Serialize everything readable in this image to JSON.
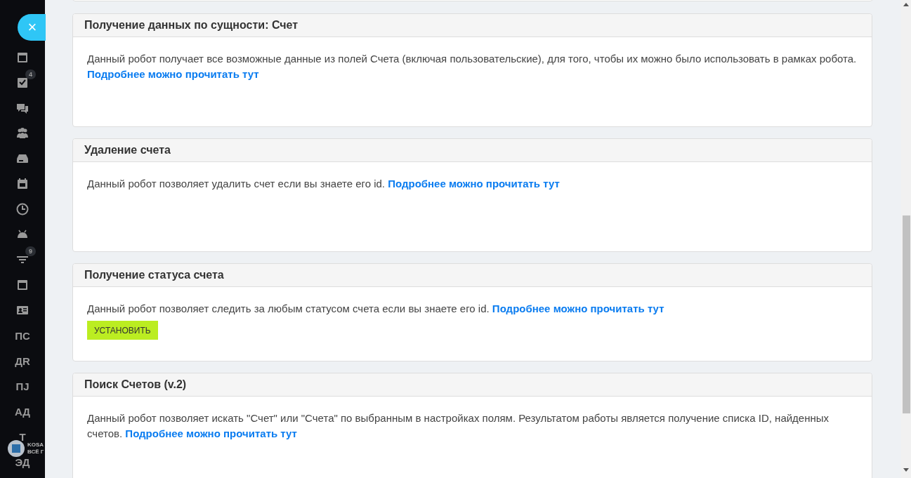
{
  "sidebar": {
    "close_button": "×",
    "items": [
      {
        "kind": "icon"
      },
      {
        "kind": "icon",
        "badge": "4"
      },
      {
        "kind": "icon"
      },
      {
        "kind": "icon"
      },
      {
        "kind": "icon"
      },
      {
        "kind": "icon"
      },
      {
        "kind": "icon"
      },
      {
        "kind": "icon"
      },
      {
        "kind": "icon",
        "badge": "9"
      },
      {
        "kind": "icon"
      },
      {
        "kind": "icon"
      },
      {
        "kind": "text",
        "label": "ПС"
      },
      {
        "kind": "text",
        "label": "ДR"
      },
      {
        "kind": "text",
        "label": "ПJ"
      },
      {
        "kind": "text",
        "label": "АД"
      },
      {
        "kind": "text",
        "label": "Т"
      },
      {
        "kind": "text",
        "label": "ЭД"
      }
    ],
    "logo": {
      "line_1": "KOSA",
      "line_2": "ВСЁ Г"
    }
  },
  "cards": [
    {
      "title": "Получение данных по сущности: Счет",
      "description": "Данный робот получает все возможные данные из полей Счета (включая пользовательские), для того, чтобы их можно было использовать в рамках робота.",
      "link": "Подробнее можно прочитать тут"
    },
    {
      "title": "Удаление счета",
      "description": "Данный робот позволяет удалить счет если вы знаете его id.",
      "link": "Подробнее можно прочитать тут"
    },
    {
      "title": "Получение статуса счета",
      "description": "Данный робот позволяет следить за любым статусом счета если вы знаете его id.",
      "link": "Подробнее можно прочитать тут",
      "button": "УСТАНОВИТЬ"
    },
    {
      "title": "Поиск Счетов (v.2)",
      "description": "Данный робот позволяет искать \"Счет\" или \"Счета\" по выбранным в настройках полям. Результатом работы является получение списка ID, найденных счетов.",
      "link": "Подробнее можно прочитать тут"
    }
  ]
}
